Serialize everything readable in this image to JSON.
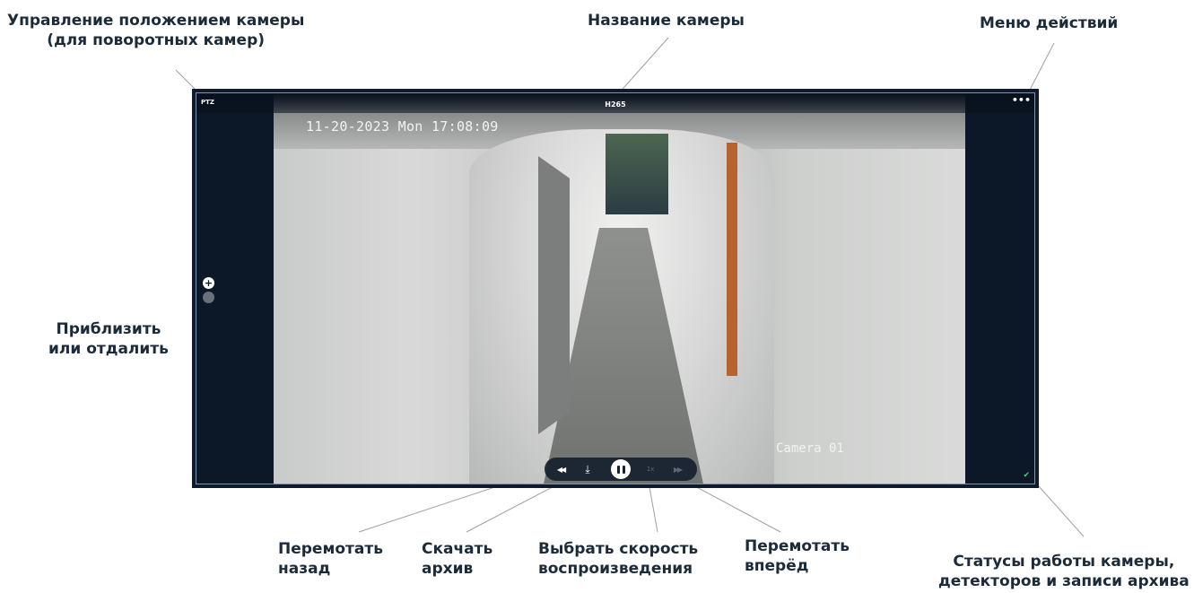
{
  "callouts": {
    "ptz_line1": "Управление положением камеры",
    "ptz_line2": "(для поворотных камер)",
    "camera_name": "Название камеры",
    "actions_menu": "Меню действий",
    "zoom_line1": "Приблизить",
    "zoom_line2": "или отдалить",
    "rewind_line1": "Перемотать",
    "rewind_line2": "назад",
    "download_line1": "Скачать",
    "download_line2": "архив",
    "speed_line1": "Выбрать скорость",
    "speed_line2": "воспроизведения",
    "forward_line1": "Перемотать",
    "forward_line2": "вперёд",
    "status_line1": "Статусы работы камеры,",
    "status_line2": "детекторов и записи архива"
  },
  "tile": {
    "ptz_label": "PTZ",
    "camera_title": "H265",
    "more_icon": "•••",
    "osd_datetime": "11-20-2023 Mon 17:08:09",
    "osd_camera": "Camera 01",
    "zoom_in_icon": "+",
    "zoom_out_icon": "−",
    "status_icon": "✔"
  },
  "playback": {
    "rewind_icon": "◀◀",
    "download_icon": "⤓",
    "speed_label": "1x",
    "forward_icon": "▶▶"
  },
  "colors": {
    "tile_background": "#0c1827",
    "tile_border": "#7f93b6",
    "status_ok": "#4bd06a",
    "callout_text": "#1c2b3a"
  }
}
